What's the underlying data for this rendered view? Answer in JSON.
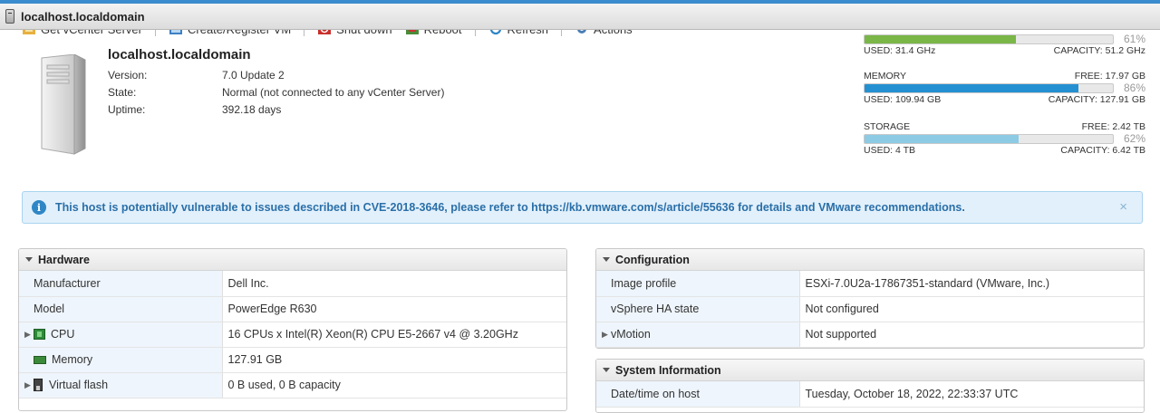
{
  "window": {
    "title": "localhost.localdomain"
  },
  "toolbar": {
    "items": [
      {
        "label": "Get vCenter Server",
        "icon": "vcenter-icon"
      },
      {
        "label": "Create/Register VM",
        "icon": "create-vm-icon"
      },
      {
        "label": "Shut down",
        "icon": "shutdown-icon"
      },
      {
        "label": "Reboot",
        "icon": "reboot-icon"
      },
      {
        "label": "Refresh",
        "icon": "refresh-icon"
      },
      {
        "label": "Actions",
        "icon": "gear-icon"
      }
    ]
  },
  "host": {
    "name": "localhost.localdomain",
    "version_label": "Version:",
    "version": "7.0 Update 2",
    "state_label": "State:",
    "state": "Normal (not connected to any vCenter Server)",
    "uptime_label": "Uptime:",
    "uptime": "392.18 days"
  },
  "resources": {
    "cpu": {
      "percent": "61%",
      "fill": 0.61,
      "color": "#7ab648",
      "used": "USED: 31.4 GHz",
      "capacity": "CAPACITY: 51.2 GHz"
    },
    "memory": {
      "label": "MEMORY",
      "free": "FREE: 17.97 GB",
      "percent": "86%",
      "fill": 0.86,
      "color": "#2590d1",
      "used": "USED: 109.94 GB",
      "capacity": "CAPACITY: 127.91 GB"
    },
    "storage": {
      "label": "STORAGE",
      "free": "FREE: 2.42 TB",
      "percent": "62%",
      "fill": 0.62,
      "color": "#8ccbe3",
      "used": "USED: 4 TB",
      "capacity": "CAPACITY: 6.42 TB"
    }
  },
  "alert": {
    "message": "This host is potentially vulnerable to issues described in CVE-2018-3646, please refer to https://kb.vmware.com/s/article/55636 for details and VMware recommendations.",
    "close": "×"
  },
  "hardware": {
    "title": "Hardware",
    "rows": [
      {
        "label": "Manufacturer",
        "value": "Dell Inc."
      },
      {
        "label": "Model",
        "value": "PowerEdge R630"
      },
      {
        "label": "CPU",
        "value": "16 CPUs x Intel(R) Xeon(R) CPU E5-2667 v4 @ 3.20GHz"
      },
      {
        "label": "Memory",
        "value": "127.91 GB"
      },
      {
        "label": "Virtual flash",
        "value": "0 B used, 0 B capacity"
      }
    ]
  },
  "configuration": {
    "title": "Configuration",
    "rows": [
      {
        "label": "Image profile",
        "value": "ESXi-7.0U2a-17867351-standard (VMware, Inc.)"
      },
      {
        "label": "vSphere HA state",
        "value": "Not configured"
      },
      {
        "label": "vMotion",
        "value": "Not supported"
      }
    ]
  },
  "system_info": {
    "title": "System Information",
    "rows": [
      {
        "label": "Date/time on host",
        "value": "Tuesday, October 18, 2022, 22:33:37 UTC"
      }
    ]
  }
}
